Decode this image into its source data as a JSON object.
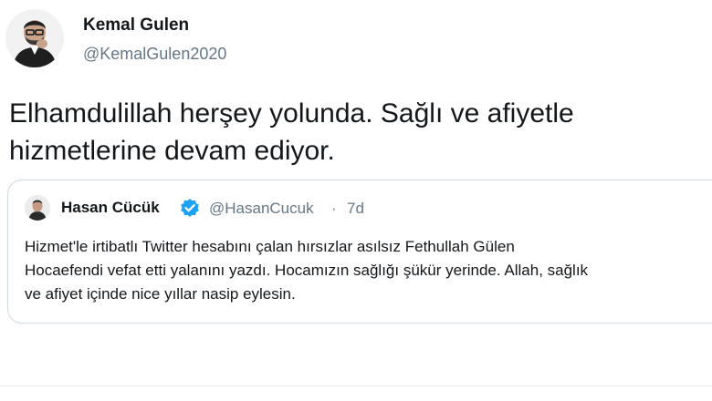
{
  "author": {
    "name": "Kemal Gulen",
    "handle": "@KemalGulen2020"
  },
  "tweet": {
    "lines": [
      "Elhamdulillah herşey yolunda. Sağlı ve afiyetle",
      "hizmetlerine devam ediyor."
    ]
  },
  "quoted": {
    "name": "Hasan Cücük",
    "handle": "@HasanCucuk",
    "separator": "·",
    "time": "7d",
    "verified_color": "#1da1f2",
    "lines": [
      "Hizmet'le irtibatlı Twitter hesabını çalan hırsızlar asılsız Fethullah Gülen",
      "Hocaefendi vefat etti yalanını yazdı. Hocamızın sağlığı şükür yerinde. Allah, sağlık",
      "ve afiyet içinde nice yıllar nasip eylesin."
    ]
  }
}
